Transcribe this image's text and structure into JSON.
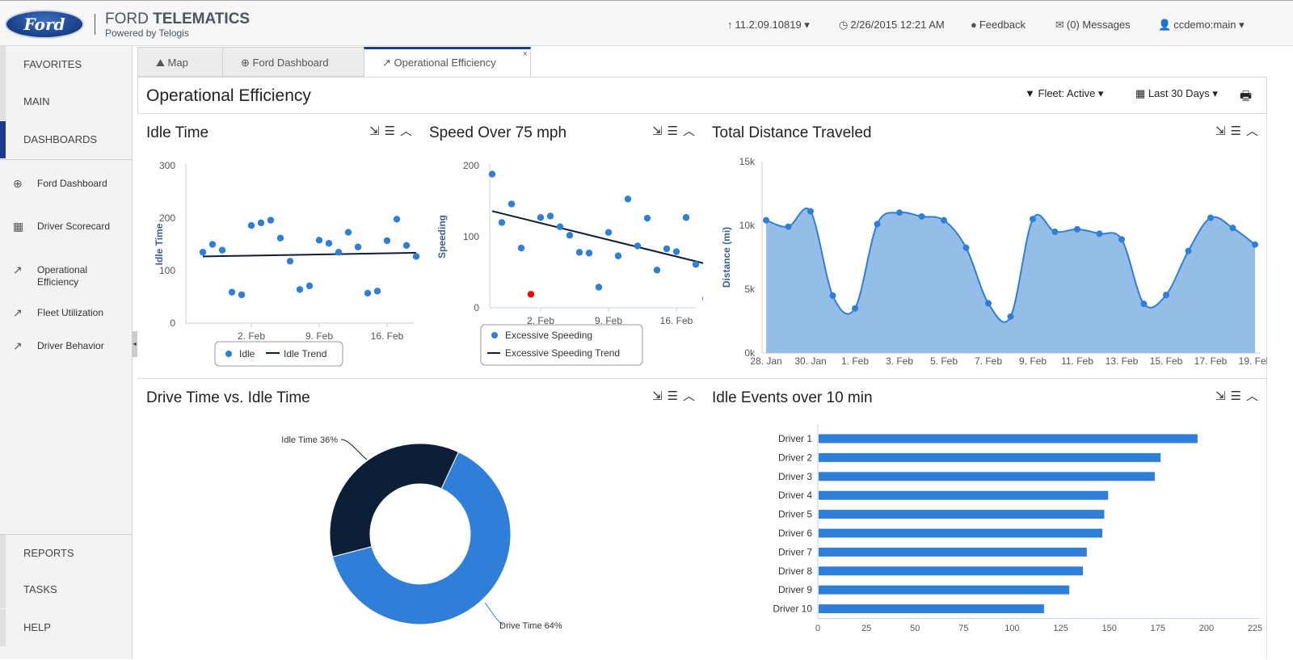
{
  "header": {
    "logo": "Ford",
    "brand_light": "FORD",
    "brand_bold": "TELEMATICS",
    "brand_sub": "Powered by Telogis",
    "version": "11.2.09.10819",
    "datetime": "2/26/2015 12:21 AM",
    "feedback": "Feedback",
    "messages": "(0) Messages",
    "user": "ccdemo:main"
  },
  "sidebar": {
    "top": [
      {
        "label": "FAVORITES"
      },
      {
        "label": "MAIN"
      },
      {
        "label": "DASHBOARDS"
      }
    ],
    "dashboards": [
      {
        "label": "Ford Dashboard",
        "icon": "globe-chart-icon"
      },
      {
        "label": "Driver Scorecard",
        "icon": "scorecard-icon"
      },
      {
        "label": "Operational Efficiency",
        "icon": "trend-chart-icon"
      },
      {
        "label": "Fleet Utilization",
        "icon": "trend-chart-icon"
      },
      {
        "label": "Driver Behavior",
        "icon": "trend-chart-icon"
      }
    ],
    "bottom": [
      {
        "label": "REPORTS"
      },
      {
        "label": "TASKS"
      },
      {
        "label": "HELP"
      }
    ]
  },
  "tabs": [
    {
      "label": "Map",
      "icon": "map-pin-icon"
    },
    {
      "label": "Ford Dashboard",
      "icon": "globe-chart-icon"
    },
    {
      "label": "Operational Efficiency",
      "icon": "trend-chart-icon",
      "active": true,
      "close": "×"
    }
  ],
  "page": {
    "title": "Operational Efficiency",
    "fleet_filter": "Fleet: Active",
    "date_range": "Last 30 Days"
  },
  "colors": {
    "accent": "#1a3b8f",
    "series": "#2f7ed8",
    "area_fill": "#94bde8",
    "dark": "#0d1f36",
    "outlier": "#ff0000"
  },
  "chart_data": [
    {
      "id": "idle",
      "type": "scatter",
      "title": "Idle Time",
      "ylabel": "Idle Time",
      "ylim": [
        0,
        300
      ],
      "yticks": [
        0,
        100,
        200,
        300
      ],
      "xticks": [
        "2. Feb",
        "9. Feb",
        "16. Feb"
      ],
      "x_start": "28. Jan",
      "x_end": "19. Feb",
      "series": [
        {
          "name": "Idle",
          "values": [
            135,
            150,
            139,
            59,
            54,
            186,
            191,
            196,
            162,
            118,
            64,
            71,
            158,
            152,
            135,
            173,
            145,
            57,
            61,
            157,
            198,
            148,
            127
          ]
        },
        {
          "name": "Idle Trend",
          "type": "line",
          "values": [
            127,
            134
          ]
        }
      ]
    },
    {
      "id": "speed",
      "type": "scatter",
      "title": "Speed Over 75 mph",
      "ylabel": "Speeding",
      "ylim": [
        0,
        200
      ],
      "yticks": [
        0,
        100,
        200
      ],
      "xticks": [
        "2. Feb",
        "9. Feb",
        "16. Feb"
      ],
      "x_start": "28. Jan",
      "x_end": "19. Feb",
      "outlier_index": 4,
      "series": [
        {
          "name": "Excessive Speeding",
          "values": [
            188,
            120,
            146,
            84,
            19,
            127,
            129,
            114,
            102,
            78,
            77,
            29,
            106,
            73,
            153,
            87,
            126,
            53,
            83,
            79,
            127,
            61,
            13
          ]
        },
        {
          "name": "Excessive Speeding Trend",
          "type": "line",
          "values": [
            136,
            62
          ]
        }
      ]
    },
    {
      "id": "distance",
      "type": "area",
      "title": "Total Distance Traveled",
      "ylabel": "Distance (mi)",
      "ylim": [
        0,
        15
      ],
      "yticks": [
        "0k",
        "5k",
        "10k",
        "15k"
      ],
      "xticks": [
        "28. Jan",
        "30. Jan",
        "1. Feb",
        "3. Feb",
        "5. Feb",
        "7. Feb",
        "9. Feb",
        "11. Feb",
        "13. Feb",
        "15. Feb",
        "17. Feb",
        "19. Feb"
      ],
      "values_k": [
        10.4,
        9.9,
        11.1,
        4.5,
        3.5,
        10.1,
        11.0,
        10.7,
        10.4,
        8.25,
        3.9,
        2.85,
        10.5,
        9.5,
        9.7,
        9.35,
        8.9,
        3.85,
        4.55,
        8.0,
        10.6,
        9.8,
        8.5
      ]
    },
    {
      "id": "drive",
      "type": "pie",
      "title": "Drive Time vs. Idle Time",
      "slices": [
        {
          "label": "Drive Time 64%",
          "value": 64
        },
        {
          "label": "Idle Time 36%",
          "value": 36
        }
      ]
    },
    {
      "id": "events",
      "type": "bar",
      "title": "Idle Events over 10 min",
      "xlim": [
        0,
        225
      ],
      "xticks": [
        0,
        25,
        50,
        75,
        100,
        125,
        150,
        175,
        200,
        225
      ],
      "categories": [
        "Driver 1",
        "Driver 2",
        "Driver 3",
        "Driver 4",
        "Driver 5",
        "Driver 6",
        "Driver 7",
        "Driver 8",
        "Driver 9",
        "Driver 10"
      ],
      "values": [
        195,
        176,
        173,
        149,
        147,
        146,
        138,
        136,
        129,
        116
      ]
    }
  ]
}
